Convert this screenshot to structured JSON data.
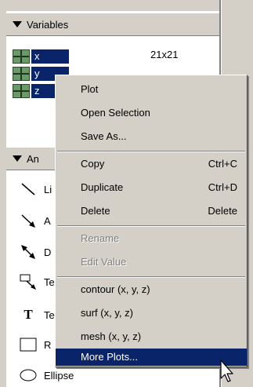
{
  "variables": {
    "header": "Variables",
    "items": [
      {
        "name": "x",
        "size": "21x21"
      },
      {
        "name": "y",
        "size": ""
      },
      {
        "name": "z",
        "size": ""
      }
    ]
  },
  "annotations": {
    "header": "An",
    "items": [
      {
        "label": "Li",
        "icon": "line-icon"
      },
      {
        "label": "A",
        "icon": "arrow-icon"
      },
      {
        "label": "D",
        "icon": "double-arrow-icon"
      },
      {
        "label": "Te",
        "icon": "text-arrow-icon"
      },
      {
        "label": "Te",
        "icon": "text-icon"
      },
      {
        "label": "R",
        "icon": "rectangle-icon"
      },
      {
        "label": "Ellipse",
        "icon": "ellipse-icon"
      }
    ]
  },
  "context_menu": {
    "plot": "Plot",
    "open_selection": "Open Selection",
    "save_as": "Save As...",
    "copy": "Copy",
    "copy_shortcut": "Ctrl+C",
    "duplicate": "Duplicate",
    "duplicate_shortcut": "Ctrl+D",
    "delete": "Delete",
    "delete_shortcut": "Delete",
    "rename": "Rename",
    "edit_value": "Edit Value",
    "contour": "contour (x, y, z)",
    "surf": "surf (x, y, z)",
    "mesh": "mesh (x, y, z)",
    "more_plots": "More Plots..."
  }
}
